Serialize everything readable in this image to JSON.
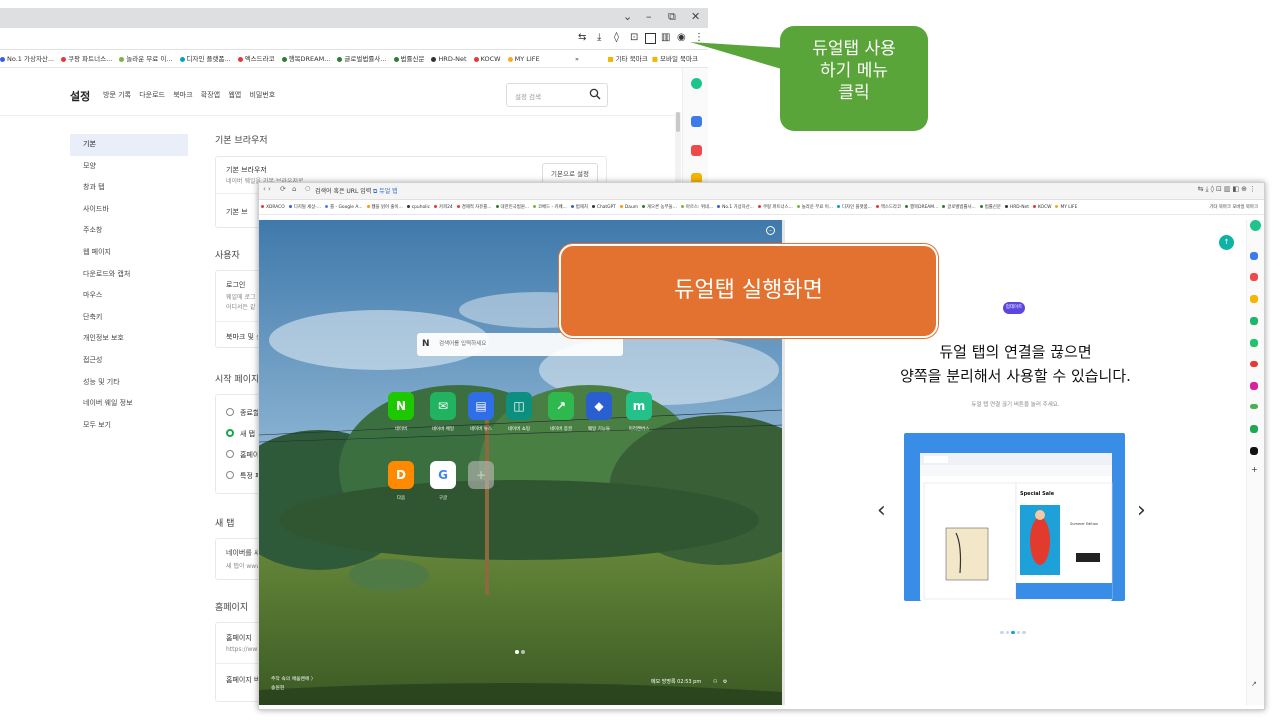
{
  "back_window": {
    "bookmarks": [
      {
        "label": "No.1 가상자산...",
        "color": "#3b5fd6"
      },
      {
        "label": "쿠팡 파트너스...",
        "color": "#e53935"
      },
      {
        "label": "놀라운 무료 이...",
        "color": "#7cb342"
      },
      {
        "label": "디자인 플랫폼...",
        "color": "#00a3c4"
      },
      {
        "label": "엑스드라코",
        "color": "#e53935"
      },
      {
        "label": "행복DREAM...",
        "color": "#2e7d32"
      },
      {
        "label": "글로벌법률사...",
        "color": "#2e7d32"
      },
      {
        "label": "법률신문",
        "color": "#2e7d32"
      },
      {
        "label": "HRD-Net",
        "color": "#333333"
      },
      {
        "label": "KOCW",
        "color": "#e53935"
      },
      {
        "label": "MY LIFE",
        "color": "#f9a825"
      }
    ],
    "bookmarks_more": "»",
    "bookmarks_right": [
      "기타 북마크",
      "모바일 북마크"
    ],
    "settings": {
      "title": "설정",
      "nav": [
        "방문 기록",
        "다운로드",
        "북마크",
        "확장앱",
        "웹앱",
        "비밀번호"
      ],
      "search_placeholder": "설정 검색",
      "sidebar": [
        "기본",
        "모양",
        "창과 탭",
        "사이드바",
        "주소창",
        "웹 페이지",
        "다운로드와 캡처",
        "마우스",
        "단축키",
        "개인정보 보호",
        "접근성",
        "성능 및 기타",
        "네이버 웨일 정보",
        "모두 보기"
      ],
      "sections": {
        "default_browser": {
          "heading": "기본 브라우저",
          "label": "기본 브라우저",
          "sub": "네이버 웨일을 기본 브라우저로",
          "button": "기본으로 설정",
          "row2": "기본 브"
        },
        "user": {
          "heading": "사용자",
          "label": "로그인",
          "sub1": "웨일에 로그",
          "sub2": "어디서든 같",
          "row2": "북마크 및 설"
        },
        "startup": {
          "heading": "시작 페이지",
          "options": [
            "종료할",
            "새 탭",
            "홈페이",
            "특정 페"
          ]
        },
        "new_tab": {
          "heading": "새 탭",
          "label": "네이버를 새",
          "sub": "새 탭이 www"
        },
        "homepage": {
          "heading": "홈페이지",
          "label": "홈페이지",
          "sub": "https://ww",
          "row2": "홈페이지 버"
        }
      }
    }
  },
  "callout_green": "듀얼탭 사용\n하기 메뉴\n클릭",
  "callout_orange": "듀얼탭 실행화면",
  "front_window": {
    "url_placeholder": "검색어 혹은 URL 입력",
    "dual_tab_button": "듀얼 탭",
    "bookmarks": [
      {
        "label": "XDRACO",
        "color": "#e53935"
      },
      {
        "label": "디지털 세상-...",
        "color": "#3b5fd6"
      },
      {
        "label": "를 - Google A...",
        "color": "#4285f4"
      },
      {
        "label": "웹을 읽어 줄이...",
        "color": "#ff9800"
      },
      {
        "label": "cpuholic",
        "color": "#333333"
      },
      {
        "label": "카피24",
        "color": "#e53935"
      },
      {
        "label": "경제적 자유를...",
        "color": "#e53935"
      },
      {
        "label": "대한민국법원...",
        "color": "#2e7d32"
      },
      {
        "label": "코베드 - 카페...",
        "color": "#7cb342"
      },
      {
        "label": "법제처",
        "color": "#3b5fd6"
      },
      {
        "label": "ChatGPT",
        "color": "#333333"
      },
      {
        "label": "Daum",
        "color": "#ff9800"
      },
      {
        "label": "게으른 농부들...",
        "color": "#2e7d32"
      },
      {
        "label": "아르스: 위네...",
        "color": "#7cb342"
      },
      {
        "label": "No.1 가상자산...",
        "color": "#3b5fd6"
      },
      {
        "label": "쿠팡 파트너스...",
        "color": "#e53935"
      },
      {
        "label": "놀라운 무료 이...",
        "color": "#7cb342"
      },
      {
        "label": "디자인 플랫폼...",
        "color": "#00a3c4"
      },
      {
        "label": "엑스드라코",
        "color": "#e53935"
      },
      {
        "label": "행복DREAM...",
        "color": "#2e7d32"
      },
      {
        "label": "글로벌법률사...",
        "color": "#2e7d32"
      },
      {
        "label": "법률신문",
        "color": "#2e7d32"
      },
      {
        "label": "HRD-Net",
        "color": "#333333"
      },
      {
        "label": "KOCW",
        "color": "#e53935"
      },
      {
        "label": "MY LIFE",
        "color": "#f9a825"
      }
    ],
    "bookmarks_right": "기타 북마크  모바일 북마크",
    "left_pane": {
      "search_placeholder": "검색어를 입력하세요",
      "apps": [
        {
          "label": "네이버",
          "glyph": "N",
          "color": "#1ec800"
        },
        {
          "label": "네이버 메일",
          "glyph": "✉",
          "color": "#21b35f"
        },
        {
          "label": "네이버 뉴스",
          "glyph": "▤",
          "color": "#2f6ee6"
        },
        {
          "label": "네이버 쇼핑",
          "glyph": "◫",
          "color": "#0c8f7f"
        },
        {
          "label": "네이버 증권",
          "glyph": "↗",
          "color": "#2fb84d"
        },
        {
          "label": "웨일 기능들",
          "glyph": "◆",
          "color": "#2a5fd1"
        },
        {
          "label": "미리캔버스",
          "glyph": "m",
          "color": "#24c18a"
        },
        {
          "label": "다음",
          "glyph": "D",
          "color": "#ff8a00"
        },
        {
          "label": "구글",
          "glyph": "G",
          "color": "#ffffff"
        },
        {
          "label": "",
          "glyph": "+",
          "color": "#bdbdbd"
        }
      ],
      "bottom_left_1": "주작 속의 애움벤에 〉",
      "bottom_left_2": "송원현",
      "bottom_right": "메모   방명록   02:53 pm"
    },
    "right_pane": {
      "pill": "업데이트",
      "title_line1": "듀얼 탭의 연결을 끊으면",
      "title_line2": "양쪽을 분리해서 사용할 수 있습니다.",
      "subtitle": "듀얼 탭 연결 끊기 버튼을 눌러 주세요.",
      "inner_special_sale": "Special Sale",
      "inner_summer": "Summer Edition"
    }
  }
}
